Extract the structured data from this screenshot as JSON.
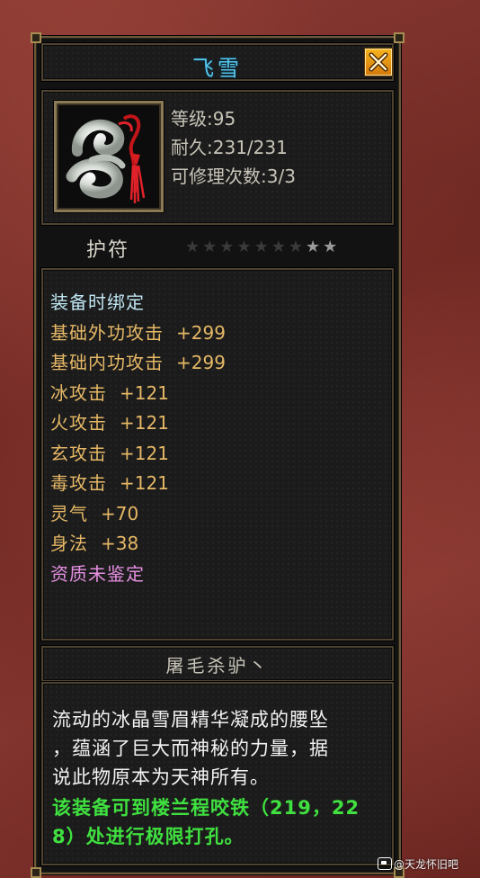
{
  "window": {
    "title": "飞雪",
    "close_icon": "close-x-icon"
  },
  "item": {
    "icon": "jade-pendant-icon",
    "level_label": "等级:",
    "level_value": "95",
    "durability_label": "耐久:",
    "durability_value": "231/231",
    "repair_label": "可修理次数:",
    "repair_value": "3/3"
  },
  "category": {
    "label": "护符",
    "stars_total": 9,
    "stars_filled": 2,
    "star_icon": "star-icon"
  },
  "attributes": [
    {
      "name": "装备时绑定",
      "value": "",
      "color": "#bfe6f2"
    },
    {
      "name": "基础外功攻击",
      "value": "+299",
      "color": "#e6b866"
    },
    {
      "name": "基础内功攻击",
      "value": "+299",
      "color": "#e6b866"
    },
    {
      "name": "冰攻击",
      "value": "+121",
      "color": "#e6b866"
    },
    {
      "name": "火攻击",
      "value": "+121",
      "color": "#e6b866"
    },
    {
      "name": "玄攻击",
      "value": "+121",
      "color": "#e6b866"
    },
    {
      "name": "毒攻击",
      "value": "+121",
      "color": "#e6b866"
    },
    {
      "name": "灵气",
      "value": "+70",
      "color": "#e6b866"
    },
    {
      "name": "身法",
      "value": "+38",
      "color": "#e6b866"
    },
    {
      "name": "资质未鉴定",
      "value": "",
      "color": "#e58fe0"
    }
  ],
  "owner": "屠毛杀驴丶",
  "description": {
    "lines": [
      "流动的冰晶雪眉精华凝成的腰坠",
      "，蕴涵了巨大而神秘的力量，据",
      "说此物原本为天神所有。"
    ],
    "hint_lines": [
      "该装备可到楼兰程咬铁（219，22",
      "8）处进行极限打孔。"
    ]
  },
  "watermark": "@天龙怀旧吧",
  "colors": {
    "title": "#56c8ee",
    "gold": "#e6b866",
    "bind": "#bfe6f2",
    "unidentified": "#e58fe0",
    "hint": "#3fe03f",
    "frame": "#4e4330"
  }
}
